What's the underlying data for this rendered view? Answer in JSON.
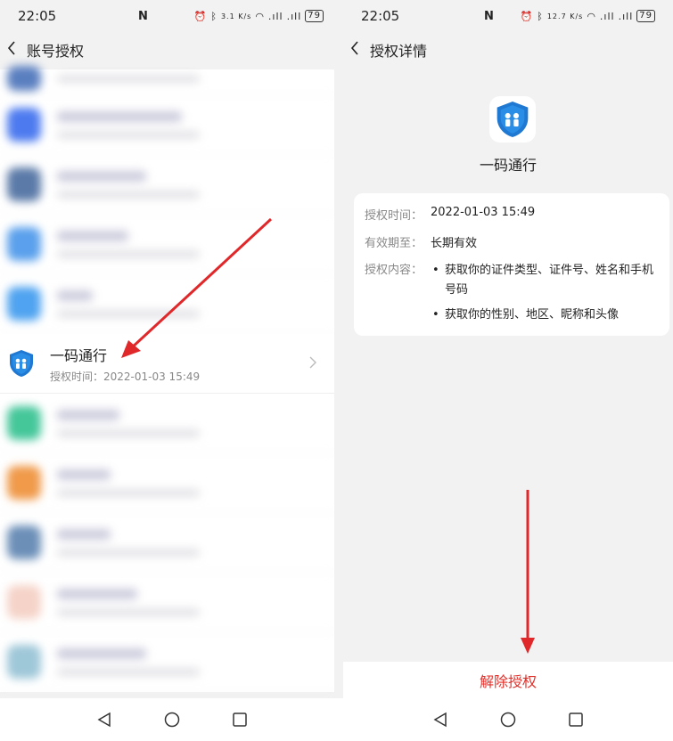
{
  "status": {
    "time": "22:05",
    "battery": "79",
    "speed_left": "3.1 K/s",
    "speed_right": "12.7 K/s"
  },
  "left": {
    "title": "账号授权",
    "app": {
      "name": "一码通行",
      "time_text": "授权时间：2022-01-03 15:49"
    }
  },
  "right": {
    "title": "授权详情",
    "app_name": "一码通行",
    "auth_time_label": "授权时间：",
    "auth_time": "2022-01-03 15:49",
    "valid_label": "有效期至：",
    "valid": "长期有效",
    "content_label": "授权内容：",
    "content_items": [
      "获取你的证件类型、证件号、姓名和手机号码",
      "获取你的性别、地区、昵称和头像"
    ],
    "revoke": "解除授权"
  },
  "colors": {
    "accent_red": "#e0302a",
    "arrow_red": "#e0282a",
    "shield_blue": "#1f78d1"
  }
}
